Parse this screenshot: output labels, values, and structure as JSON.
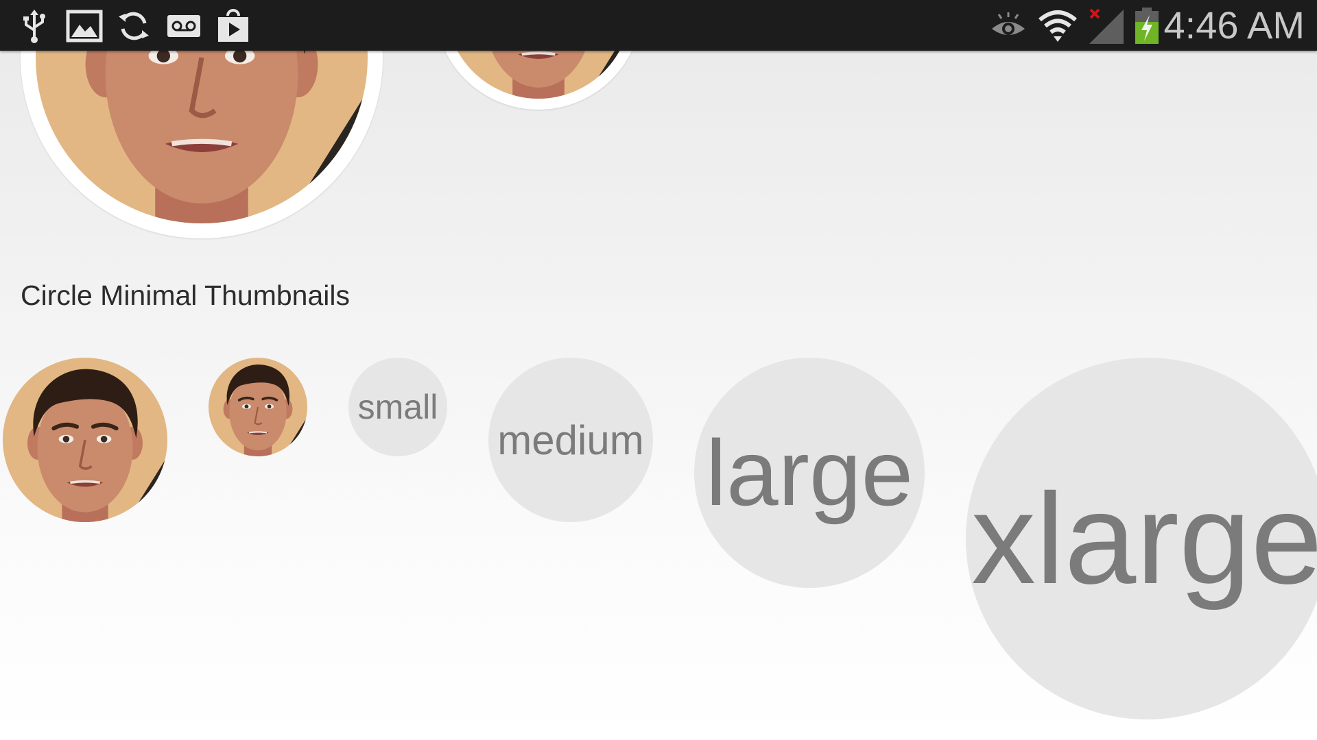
{
  "status_bar": {
    "time": "4:46 AM",
    "left_icons": [
      "usb-icon",
      "gallery-icon",
      "sync-icon",
      "voicemail-icon",
      "play-store-icon"
    ],
    "right_icons": [
      "smart-stay-eye-icon",
      "wifi-icon",
      "signal-no-service-icon",
      "battery-charging-icon"
    ]
  },
  "section": {
    "title": "Circle Minimal Thumbnails"
  },
  "bubbles": {
    "small": "small",
    "medium": "medium",
    "large": "large",
    "xlarge": "xlarge"
  },
  "colors": {
    "status_bar_bg": "#1c1c1c",
    "status_text": "#c8c8c8",
    "bubble_bg": "#e6e6e6",
    "bubble_text": "#7b7b7b",
    "skin": "#c98b6b",
    "background_photo": "#e2b783",
    "hair": "#2e1d15",
    "battery_green": "#6fb526",
    "no_signal_red": "#d01515"
  }
}
